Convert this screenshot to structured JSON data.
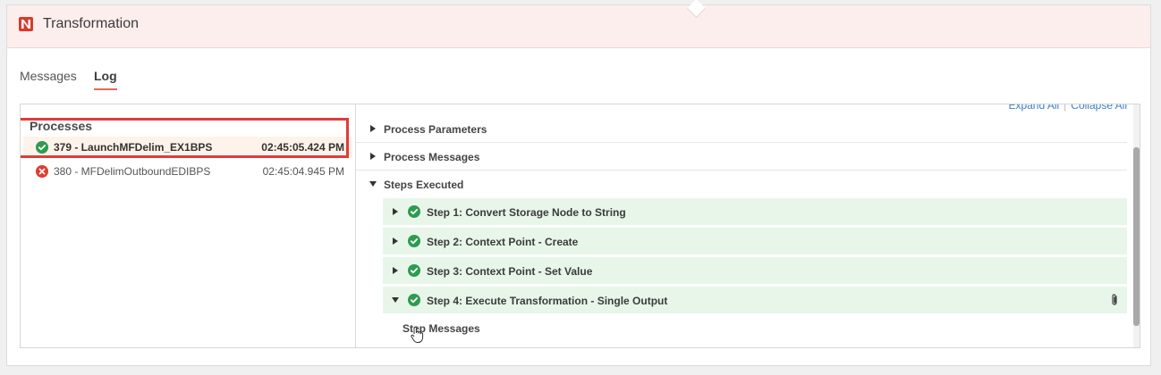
{
  "window": {
    "title": "Transformation",
    "logo_icon": "logo-icon",
    "accent": "#d93a2b"
  },
  "tabs": [
    {
      "label": "Messages",
      "active": false
    },
    {
      "label": "Log",
      "active": true
    }
  ],
  "processes": {
    "header": "Processes",
    "items": [
      {
        "name": "379 - LaunchMFDelim_EX1BPS",
        "time": "02:45:05.424 PM",
        "status": "success",
        "selected": true
      },
      {
        "name": "380 - MFDelimOutboundEDIBPS",
        "time": "02:45:04.945 PM",
        "status": "error",
        "selected": false
      }
    ]
  },
  "details": {
    "expand_all": "Expand All",
    "collapse_all": "Collapse All",
    "sections": [
      {
        "label": "Process Parameters",
        "expanded": false
      },
      {
        "label": "Process Messages",
        "expanded": false
      },
      {
        "label": "Steps Executed",
        "expanded": true
      }
    ],
    "steps": [
      {
        "label": "Step 1: Convert Storage Node to String",
        "expanded": false,
        "status": "success"
      },
      {
        "label": "Step 2: Context Point - Create",
        "expanded": false,
        "status": "success"
      },
      {
        "label": "Step 3: Context Point - Set Value",
        "expanded": false,
        "status": "success"
      },
      {
        "label": "Step 4: Execute Transformation - Single Output",
        "expanded": true,
        "status": "success",
        "attachment": true
      }
    ],
    "step_sub": "Step Messages"
  },
  "colors": {
    "success": "#2e9b4e",
    "error": "#e03c31",
    "highlight": "#e13b3b",
    "link": "#3d7fc1"
  }
}
